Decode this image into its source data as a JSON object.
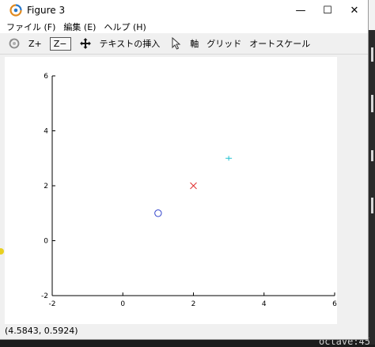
{
  "window": {
    "title": "Figure 3",
    "controls": {
      "minimize": "—",
      "maximize": "☐",
      "close": "✕"
    }
  },
  "menu": [
    {
      "label": "ファイル (F)"
    },
    {
      "label": "編集 (E)"
    },
    {
      "label": "ヘルプ (H)"
    }
  ],
  "toolbar": {
    "zoom_in": "Z+",
    "zoom_out": "Z−",
    "insert_text": "テキストの挿入",
    "axes": "軸",
    "grid": "グリッド",
    "autoscale": "オートスケール"
  },
  "status": {
    "coords": "(4.5843, 0.5924)"
  },
  "background": {
    "terminal_text": "octave:45"
  },
  "chart_data": {
    "type": "scatter",
    "xlim": [
      -2,
      6
    ],
    "ylim": [
      -2,
      6
    ],
    "x_ticks": [
      -2,
      0,
      2,
      4,
      6
    ],
    "y_ticks": [
      -2,
      0,
      2,
      4,
      6
    ],
    "grid": false,
    "series": [
      {
        "marker": "o",
        "color": "#3344cc",
        "x": 1,
        "y": 1
      },
      {
        "marker": "x",
        "color": "#e03030",
        "x": 2,
        "y": 2
      },
      {
        "marker": "+",
        "color": "#20c0d0",
        "x": 3,
        "y": 3
      }
    ]
  }
}
